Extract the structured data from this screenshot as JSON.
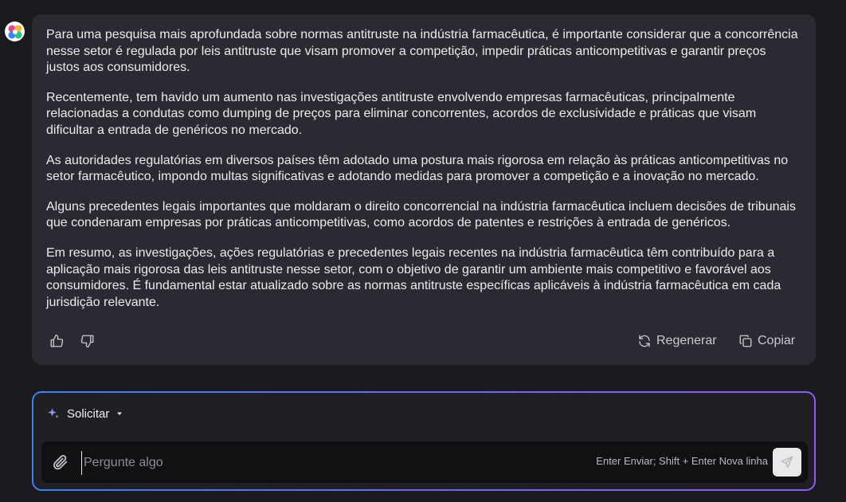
{
  "assistant": {
    "avatar_icon": "app-logo-icon",
    "paragraphs": [
      "Para uma pesquisa mais aprofundada sobre normas antitruste na indústria farmacêutica, é importante considerar que a concorrência nesse setor é regulada por leis antitruste que visam promover a competição, impedir práticas anticompetitivas e garantir preços justos aos consumidores.",
      "Recentemente, tem havido um aumento nas investigações antitruste envolvendo empresas farmacêuticas, principalmente relacionadas a condutas como dumping de preços para eliminar concorrentes, acordos de exclusividade e práticas que visam dificultar a entrada de genéricos no mercado.",
      "As autoridades regulatórias em diversos países têm adotado uma postura mais rigorosa em relação às práticas anticompetitivas no setor farmacêutico, impondo multas significativas e adotando medidas para promover a competição e a inovação no mercado.",
      "Alguns precedentes legais importantes que moldaram o direito concorrencial na indústria farmacêutica incluem decisões de tribunais que condenaram empresas por práticas anticompetitivas, como acordos de patentes e restrições à entrada de genéricos.",
      "Em resumo, as investigações, ações regulatórias e precedentes legais recentes na indústria farmacêutica têm contribuído para a aplicação mais rigorosa das leis antitruste nesse setor, com o objetivo de garantir um ambiente mais competitivo e favorável aos consumidores. É fundamental estar atualizado sobre as normas antitruste específicas aplicáveis à indústria farmacêutica em cada jurisdição relevante."
    ],
    "actions": {
      "like_icon": "thumbs-up-icon",
      "dislike_icon": "thumbs-down-icon",
      "regenerate_label": "Regenerar",
      "copy_label": "Copiar"
    }
  },
  "composer": {
    "mode_label": "Solicitar",
    "placeholder": "Pergunte algo",
    "value": "",
    "hint": "Enter Enviar; Shift + Enter Nova linha",
    "send_icon": "send-icon",
    "attach_icon": "paperclip-icon"
  },
  "colors": {
    "background": "#1b1b1f",
    "bubble": "#2a2a33",
    "accent_start": "#3b82f6",
    "accent_end": "#8b5cf6"
  }
}
